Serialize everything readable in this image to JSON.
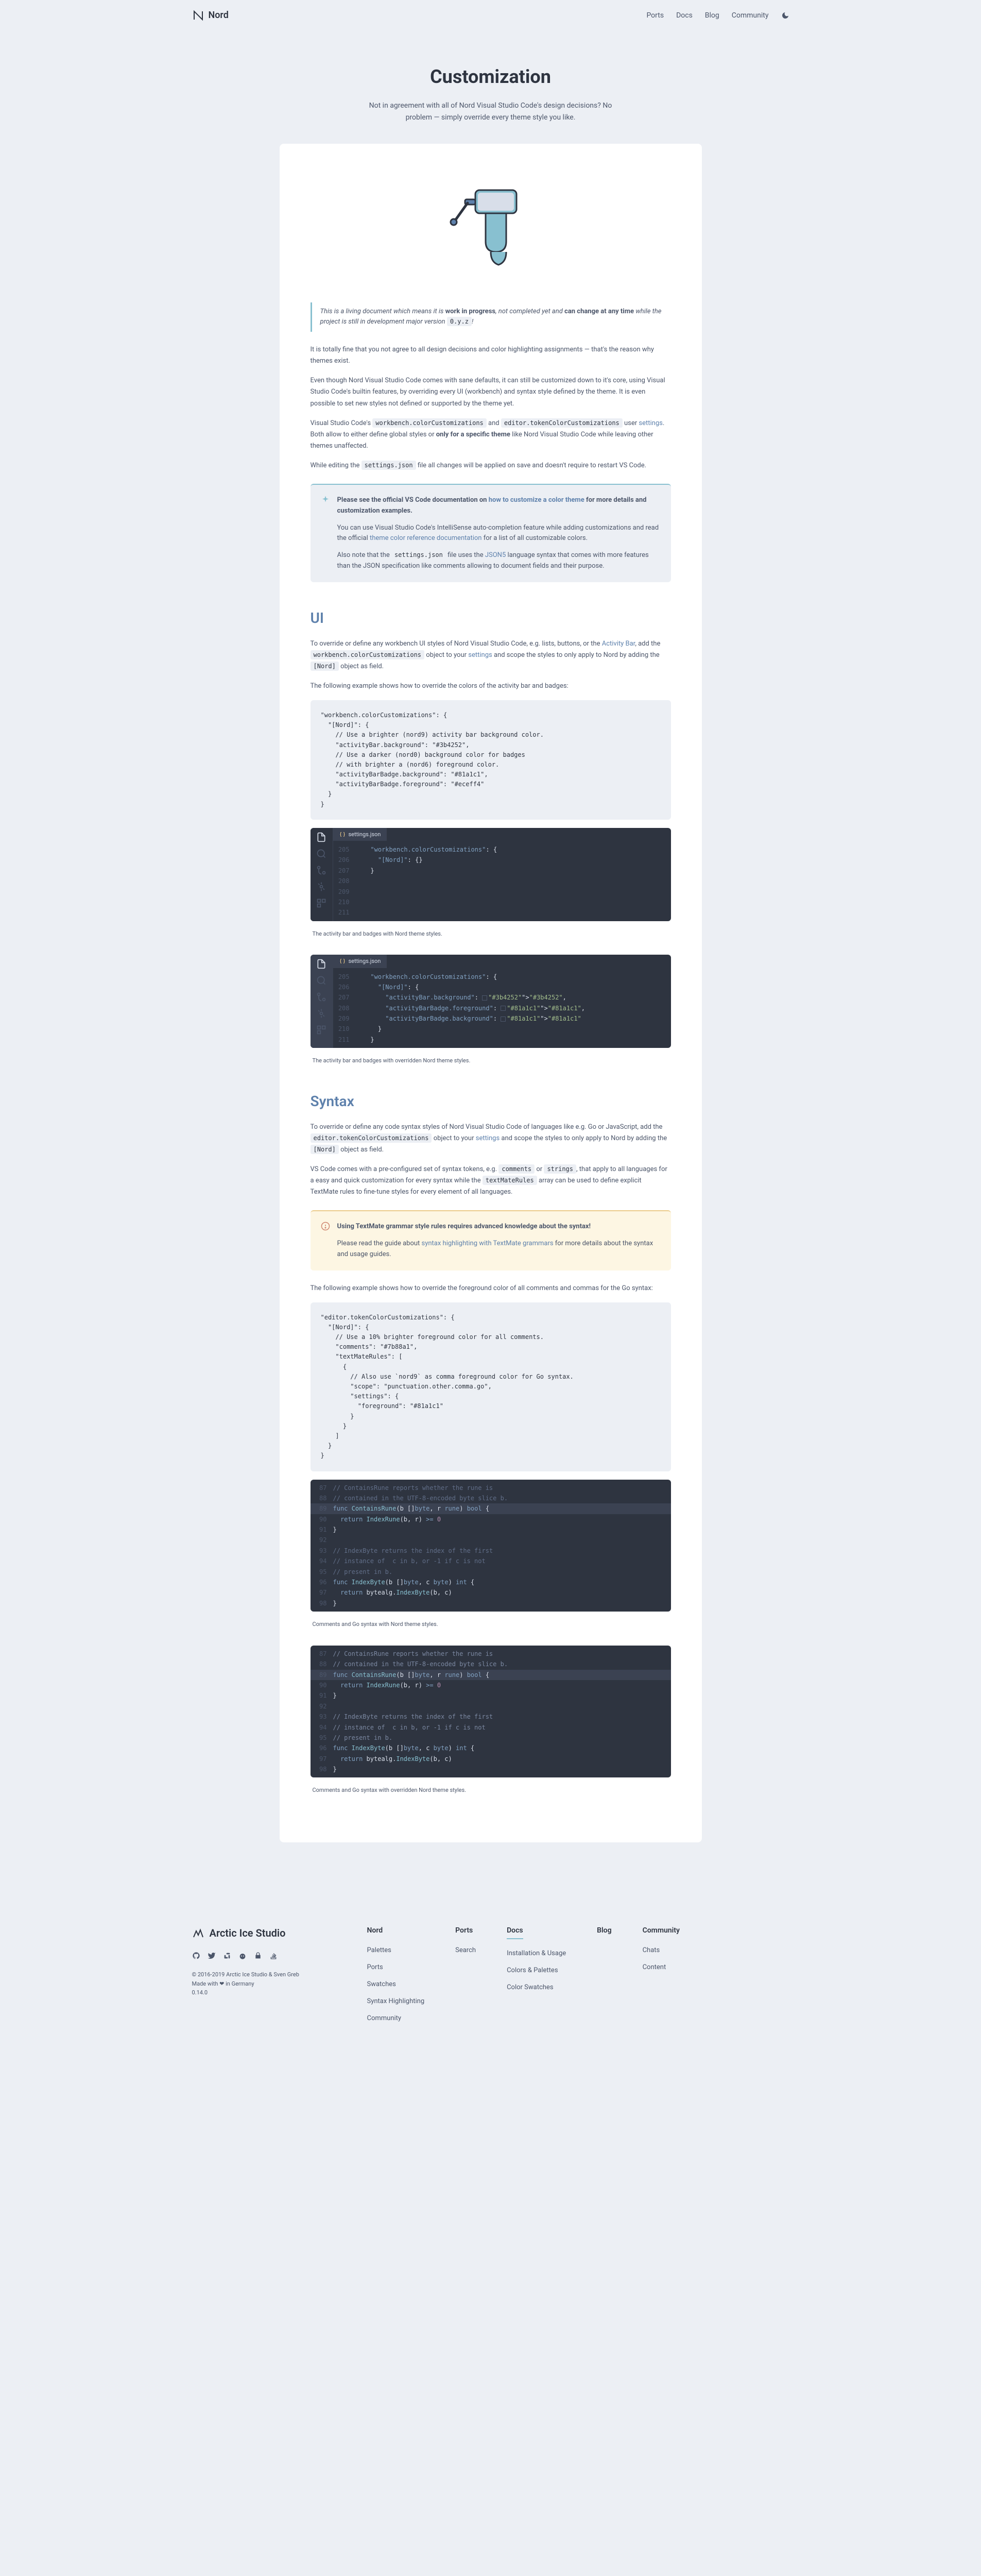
{
  "header": {
    "brand": "Nord",
    "nav": [
      "Ports",
      "Docs",
      "Blog",
      "Community"
    ]
  },
  "hero": {
    "title": "Customization",
    "subtitle": "Not in agreement with all of Nord Visual Studio Code's design decisions? No problem — simply override every theme style you like."
  },
  "callout": {
    "prefix": "This is a living document which means it is ",
    "bold1": "work in progress",
    "mid1": ", not completed yet and ",
    "bold2": "can change at any time",
    "mid2": " while the project is still in development major version ",
    "code": "0.y.z",
    "suffix": "!"
  },
  "intro": {
    "p1": "It is totally fine that you not agree to all design decisions and color highlighting assignments — that's the reason why themes exist.",
    "p2": "Even though Nord Visual Studio Code comes with sane defaults, it can still be customized down to it's core, using Visual Studio Code's builtin features, by overriding every UI (workbench) and syntax style defined by the theme. It is even possible to set new styles not defined or supported by the theme yet.",
    "p3_pre": "Visual Studio Code's ",
    "p3_code1": "workbench.colorCustomizations",
    "p3_mid1": " and ",
    "p3_code2": "editor.tokenColorCustomizations",
    "p3_mid2": " user ",
    "p3_link1": "settings",
    "p3_mid3": ". Both allow to either define global styles or ",
    "p3_bold": "only for a specific theme",
    "p3_suffix": " like Nord Visual Studio Code while leaving other themes unaffected.",
    "p4_pre": "While editing the ",
    "p4_code": "settings.json",
    "p4_suffix": " file all changes will be applied on save and doesn't require to restart VS Code."
  },
  "infobox": {
    "p1_pre": "Please see the official VS Code documentation on ",
    "p1_link": "how to customize a color theme",
    "p1_suffix": " for more details and customization examples.",
    "p2_pre": "You can use Visual Studio Code's IntelliSense auto-completion feature while adding customizations and read the official ",
    "p2_link": "theme color reference documentation",
    "p2_suffix": " for a list of all customizable colors.",
    "p3_pre": "Also note that the ",
    "p3_code": "settings.json",
    "p3_mid": " file uses the ",
    "p3_link": "JSON5",
    "p3_suffix": " language syntax that comes with more features than the JSON specification like comments allowing to document fields and their purpose."
  },
  "ui": {
    "heading": "UI",
    "p1_pre": "To override or define any workbench UI styles of Nord Visual Studio Code, e.g. lists, buttons, or the ",
    "p1_link1": "Activity Bar",
    "p1_mid1": ", add the ",
    "p1_code1": "workbench.colorCustomizations",
    "p1_mid2": " object to your ",
    "p1_link2": "settings",
    "p1_mid3": " and scope the styles to only apply to Nord by adding the ",
    "p1_code2": "[Nord]",
    "p1_suffix": " object as field.",
    "p2": "The following example shows how to override the colors of the activity bar and badges:",
    "code": "\"workbench.colorCustomizations\": {\n  \"[Nord]\": {\n    // Use a brighter (nord9) activity bar background color.\n    \"activityBar.background\": \"#3b4252\",\n    // Use a darker (nord0) background color for badges\n    // with brighter a (nord6) foreground color.\n    \"activityBarBadge.background\": \"#81a1c1\",\n    \"activityBarBadge.foreground\": \"#eceff4\"\n  }\n}",
    "caption1": "The activity bar and badges with Nord theme styles.",
    "caption2": "The activity bar and badges with overridden Nord theme styles.",
    "editor1": {
      "tab": "settings.json",
      "lines": [
        {
          "n": "205",
          "t": "    \"workbench.colorCustomizations\": {"
        },
        {
          "n": "206",
          "t": "      \"[Nord]\": {}"
        },
        {
          "n": "207",
          "t": "    }"
        },
        {
          "n": "208",
          "t": ""
        },
        {
          "n": "209",
          "t": ""
        },
        {
          "n": "210",
          "t": ""
        },
        {
          "n": "211",
          "t": ""
        }
      ]
    },
    "editor2": {
      "tab": "settings.json",
      "lines": [
        {
          "n": "205",
          "t": "    \"workbench.colorCustomizations\": {"
        },
        {
          "n": "206",
          "t": "      \"[Nord]\": {"
        },
        {
          "n": "207",
          "t": "        \"activityBar.background\": \"#3b4252\","
        },
        {
          "n": "208",
          "t": "        \"activityBarBadge.foreground\": \"#81a1c1\","
        },
        {
          "n": "209",
          "t": "        \"activityBarBadge.background\": \"#81a1c1\""
        },
        {
          "n": "210",
          "t": "      }"
        },
        {
          "n": "211",
          "t": "    }"
        }
      ]
    }
  },
  "syntax": {
    "heading": "Syntax",
    "p1_pre": "To override or define any code syntax styles of Nord Visual Studio Code of languages like e.g. Go or JavaScript, add the ",
    "p1_code1": "editor.tokenColorCustomizations",
    "p1_mid1": " object to your ",
    "p1_link": "settings",
    "p1_mid2": " and scope the styles to only apply to Nord by adding the ",
    "p1_code2": "[Nord]",
    "p1_suffix": " object as field.",
    "p2_pre": "VS Code comes with a pre-configured set of syntax tokens, e.g. ",
    "p2_code1": "comments",
    "p2_mid1": " or ",
    "p2_code2": "strings",
    "p2_mid2": ", that apply to all languages for a easy and quick customization for every syntax while the ",
    "p2_code3": "textMateRules",
    "p2_suffix": " array can be used to define explicit TextMate rules to fine-tune styles for every element of all languages.",
    "warning": {
      "bold": "Using TextMate grammar style rules requires advanced knowledge about the syntax!",
      "p2_pre": "Please read the guide about ",
      "p2_link": "syntax highlighting with TextMate grammars",
      "p2_suffix": " for more details about the syntax and usage guides."
    },
    "p3": "The following example shows how to override the foreground color of all comments and commas for the Go syntax:",
    "code": "\"editor.tokenColorCustomizations\": {\n  \"[Nord]\": {\n    // Use a 10% brighter foreground color for all comments.\n    \"comments\": \"#7b88a1\",\n    \"textMateRules\": [\n      {\n        // Also use `nord9` as comma foreground color for Go syntax.\n        \"scope\": \"punctuation.other.comma.go\",\n        \"settings\": {\n          \"foreground\": \"#81a1c1\"\n        }\n      }\n    ]\n  }\n}",
    "caption1": "Comments and Go syntax with Nord theme styles.",
    "caption2": "Comments and Go syntax with overridden Nord theme styles.",
    "go_lines": [
      {
        "n": "87",
        "t": "// ContainsRune reports whether the rune is",
        "type": "comment"
      },
      {
        "n": "88",
        "t": "// contained in the UTF-8-encoded byte slice b.",
        "type": "comment"
      },
      {
        "n": "89",
        "t": "func ContainsRune(b []byte, r rune) bool {",
        "type": "func",
        "hl": true
      },
      {
        "n": "90",
        "t": "  return IndexRune(b, r) >= 0",
        "type": "return"
      },
      {
        "n": "91",
        "t": "}",
        "type": "punct"
      },
      {
        "n": "92",
        "t": "",
        "type": "blank"
      },
      {
        "n": "93",
        "t": "// IndexByte returns the index of the first",
        "type": "comment"
      },
      {
        "n": "94",
        "t": "// instance of  c in b, or -1 if c is not",
        "type": "comment"
      },
      {
        "n": "95",
        "t": "// present in b.",
        "type": "comment"
      },
      {
        "n": "96",
        "t": "func IndexByte(b []byte, c byte) int {",
        "type": "func"
      },
      {
        "n": "97",
        "t": "  return bytealg.IndexByte(b, c)",
        "type": "return"
      },
      {
        "n": "98",
        "t": "}",
        "type": "punct"
      }
    ]
  },
  "footer": {
    "brand": "Arctic Ice Studio",
    "copy1": "© 2016-2019 Arctic Ice Studio & Sven Greb",
    "copy2": "Made with ❤ in Germany",
    "version": "0.14.0",
    "cols": [
      {
        "title": "Nord",
        "links": [
          "Palettes",
          "Ports",
          "Swatches",
          "Syntax Highlighting",
          "Community"
        ]
      },
      {
        "title": "Ports",
        "links": [
          "Search"
        ]
      },
      {
        "title": "Docs",
        "links": [
          "Installation & Usage",
          "Colors & Palettes",
          "Color Swatches"
        ],
        "active": true
      },
      {
        "title": "Blog",
        "links": []
      },
      {
        "title": "Community",
        "links": [
          "Chats",
          "Content"
        ]
      }
    ]
  }
}
